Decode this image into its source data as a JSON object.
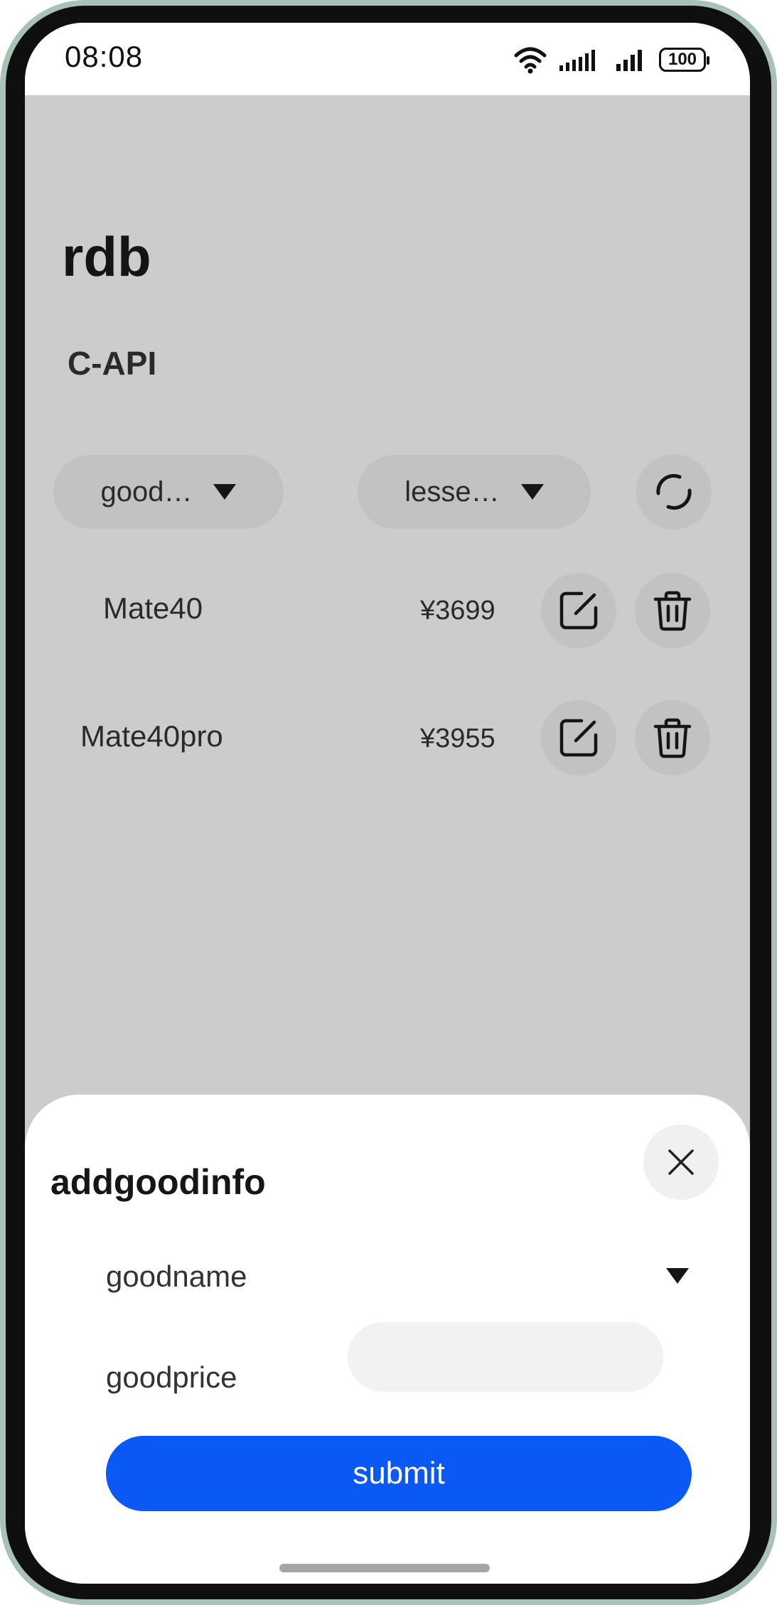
{
  "status_bar": {
    "time": "08:08",
    "battery": "100"
  },
  "page": {
    "title": "rdb",
    "subtitle": "C-API"
  },
  "filters": {
    "goods_select": "good…",
    "price_select": "lesse…"
  },
  "goods": [
    {
      "name": "Mate40",
      "price": "¥3699"
    },
    {
      "name": "Mate40pro",
      "price": "¥3955"
    }
  ],
  "sheet": {
    "title": "addgoodinfo",
    "goodname_label": "goodname",
    "goodprice_label": "goodprice",
    "goodprice_value": "",
    "submit_label": "submit"
  },
  "colors": {
    "accent": "#0a59f7",
    "overlay": "#cccccc",
    "pill": "#c2c2c2"
  }
}
